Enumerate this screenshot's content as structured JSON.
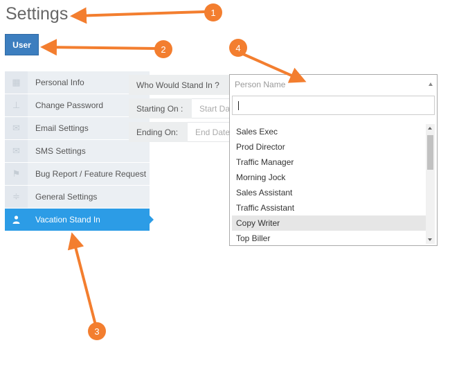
{
  "page": {
    "title": "Settings"
  },
  "user_button": {
    "label": "User"
  },
  "sidebar": {
    "items": [
      {
        "label": "Personal Info",
        "icon": "dashboard-icon"
      },
      {
        "label": "Change Password",
        "icon": "sitemap-icon"
      },
      {
        "label": "Email Settings",
        "icon": "envelope-icon"
      },
      {
        "label": "SMS Settings",
        "icon": "envelope-icon"
      },
      {
        "label": "Bug Report / Feature Request",
        "icon": "flag-icon"
      },
      {
        "label": "General Settings",
        "icon": "sliders-icon"
      },
      {
        "label": "Vacation Stand In",
        "icon": "user-icon",
        "active": true
      }
    ]
  },
  "form": {
    "stand_in_label": "Who Would Stand In ?",
    "starting_label": "Starting On :",
    "starting_placeholder": "Start Da",
    "ending_label": "Ending On:",
    "ending_placeholder": "End Date"
  },
  "dropdown": {
    "placeholder": "Person Name",
    "search_value": "",
    "options": [
      "Sales Exec",
      "Prod Director",
      "Traffic Manager",
      "Morning Jock",
      "Sales Assistant",
      "Traffic Assistant",
      "Copy Writer",
      "Top Biller"
    ],
    "highlighted": "Copy Writer"
  },
  "annotations": [
    "1",
    "2",
    "3",
    "4"
  ],
  "colors": {
    "annotation": "#f37e2f",
    "active": "#2c9ce6",
    "user_button": "#3c7ebf"
  }
}
